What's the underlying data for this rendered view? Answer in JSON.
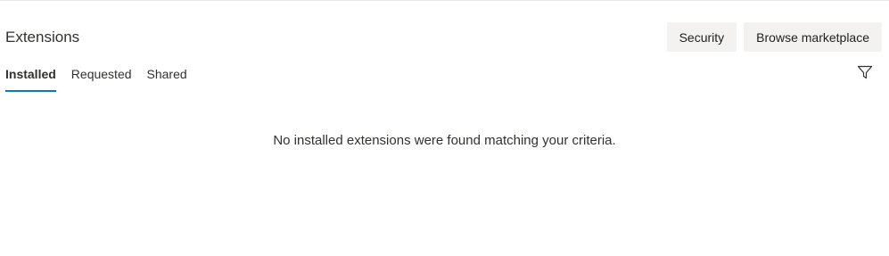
{
  "header": {
    "title": "Extensions",
    "security_label": "Security",
    "browse_label": "Browse marketplace"
  },
  "tabs": [
    {
      "label": "Installed",
      "active": true
    },
    {
      "label": "Requested",
      "active": false
    },
    {
      "label": "Shared",
      "active": false
    }
  ],
  "filter": {
    "icon": "filter-icon"
  },
  "empty_state": {
    "message": "No installed extensions were found matching your criteria."
  },
  "colors": {
    "accent": "#0078d4",
    "button_bg": "#f3f2f1"
  }
}
